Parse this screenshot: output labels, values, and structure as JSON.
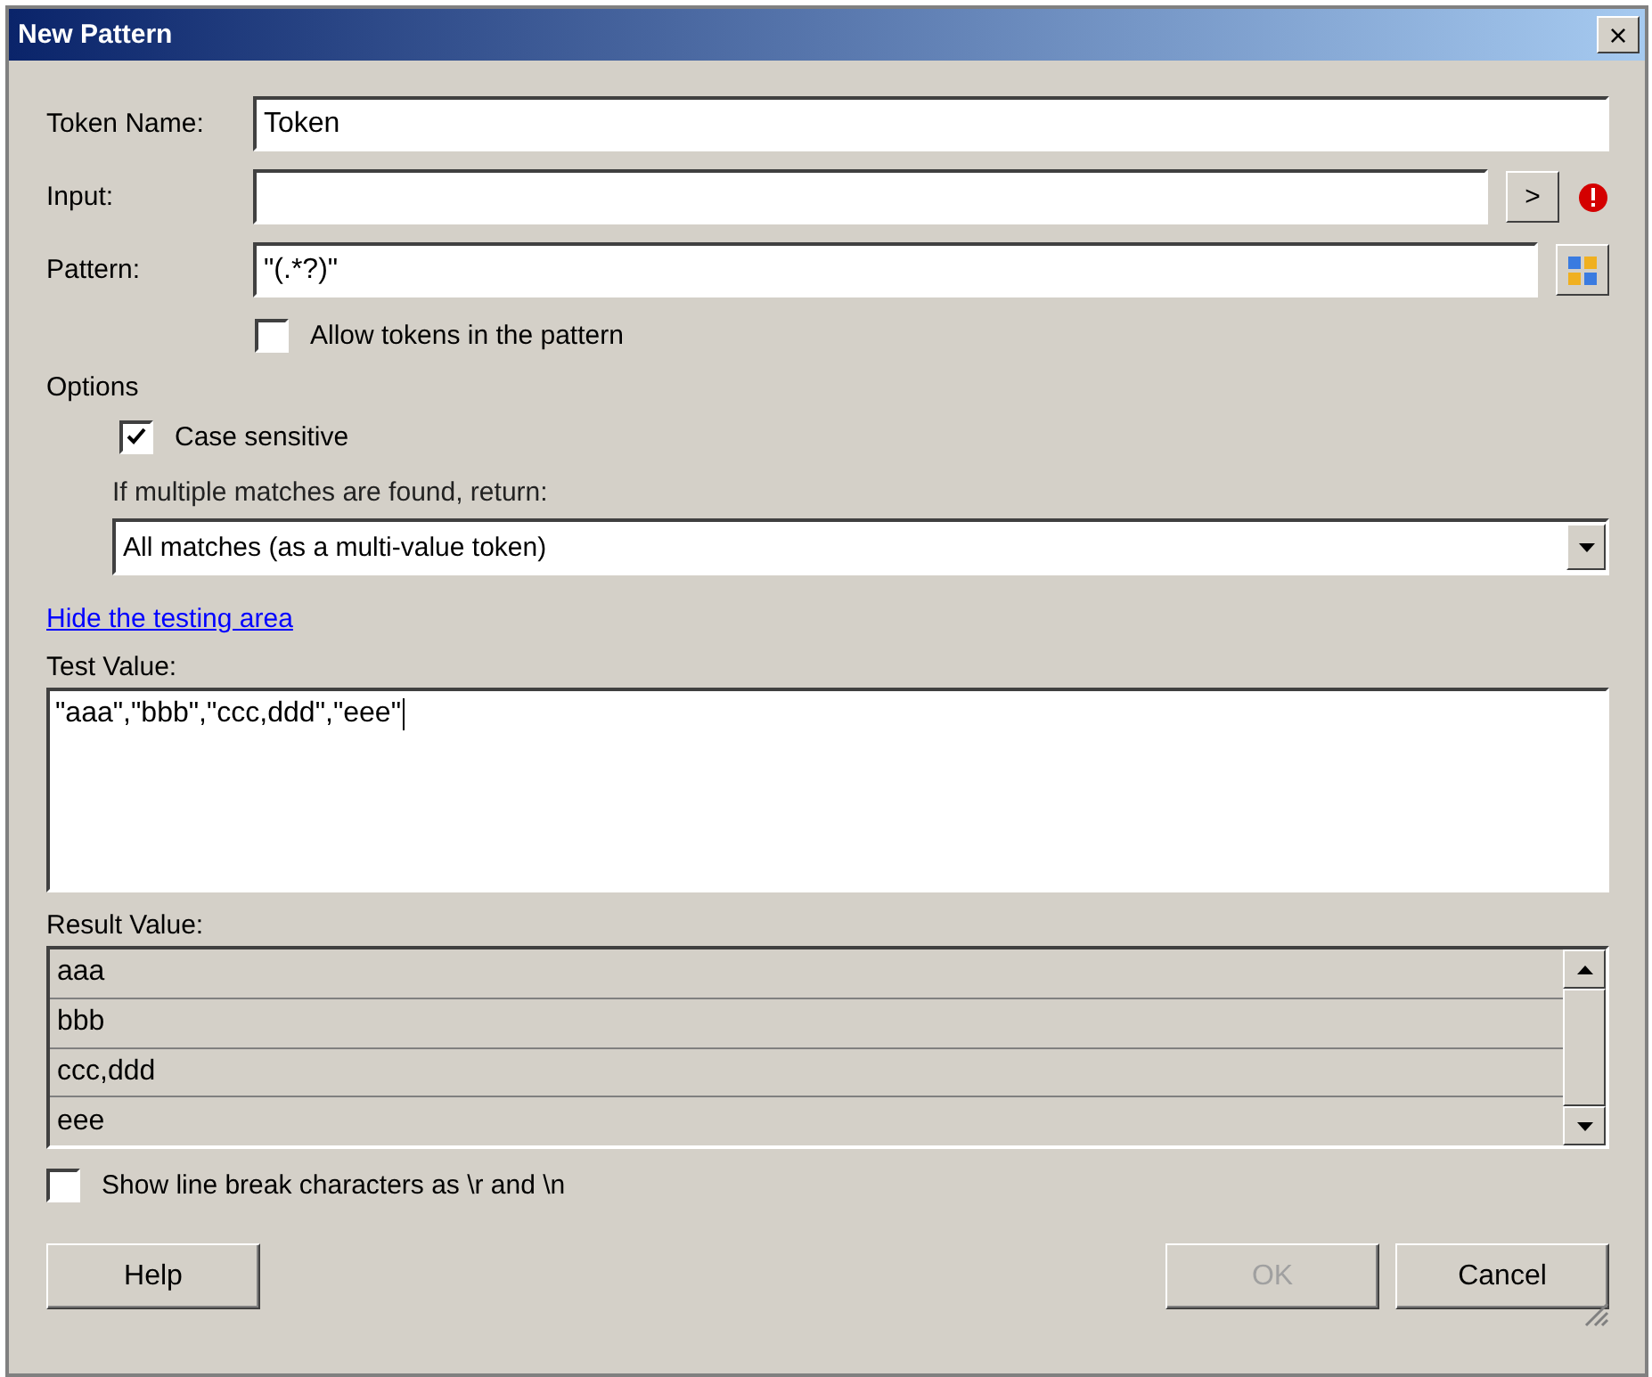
{
  "window": {
    "title": "New Pattern",
    "close": "×"
  },
  "fields": [
    {
      "kind": "text",
      "label": "Token Name:",
      "value": "Token"
    },
    {
      "kind": "input",
      "label": "Input:",
      "button": ">",
      "error": true
    },
    {
      "kind": "pattern",
      "label": "Pattern:",
      "value": "\"(.*?)\""
    }
  ],
  "allow_tokens": {
    "label": "Allow tokens in the pattern",
    "checked": false
  },
  "options": {
    "title": "Options",
    "case_sensitive": {
      "label": "Case sensitive",
      "checked": true
    },
    "multiple_label": "If multiple matches are found, return:",
    "multiple_value": "All matches (as a multi-value token)"
  },
  "link": "Hide the testing area",
  "test_value": {
    "label": "Test Value:",
    "value": "\"aaa\",\"bbb\",\"ccc,ddd\",\"eee\""
  },
  "result_value": {
    "label": "Result Value:",
    "rows": [
      "aaa",
      "bbb",
      "ccc,ddd",
      "eee"
    ]
  },
  "show_line_breaks": {
    "label": "Show line break characters as \\r and \\n",
    "checked": false
  },
  "buttons": [
    {
      "kind": "help",
      "label": "Help",
      "disabled": false
    },
    {
      "kind": "ok",
      "label": "OK",
      "disabled": true
    },
    {
      "kind": "cancel",
      "label": "Cancel",
      "disabled": false
    }
  ]
}
